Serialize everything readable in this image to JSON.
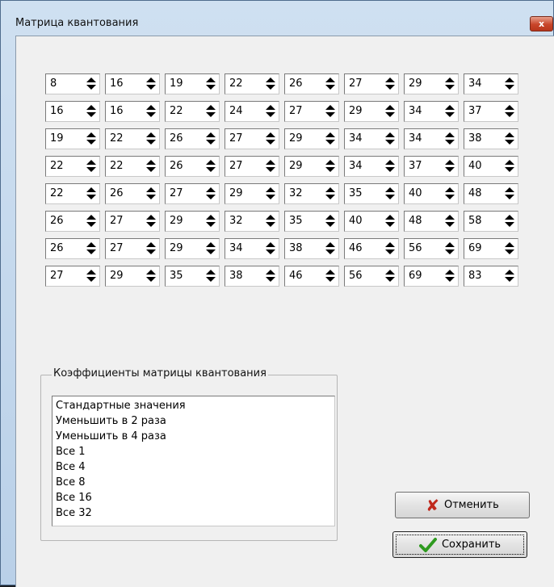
{
  "window": {
    "title": "Матрица квантования",
    "close_glyph": "x"
  },
  "matrix": [
    [
      "8",
      "16",
      "19",
      "22",
      "26",
      "27",
      "29",
      "34"
    ],
    [
      "16",
      "16",
      "22",
      "24",
      "27",
      "29",
      "34",
      "37"
    ],
    [
      "19",
      "22",
      "26",
      "27",
      "29",
      "34",
      "34",
      "38"
    ],
    [
      "22",
      "22",
      "26",
      "27",
      "29",
      "34",
      "37",
      "40"
    ],
    [
      "22",
      "26",
      "27",
      "29",
      "32",
      "35",
      "40",
      "48"
    ],
    [
      "26",
      "27",
      "29",
      "32",
      "35",
      "40",
      "48",
      "58"
    ],
    [
      "26",
      "27",
      "29",
      "34",
      "38",
      "46",
      "56",
      "69"
    ],
    [
      "27",
      "29",
      "35",
      "38",
      "46",
      "56",
      "69",
      "83"
    ]
  ],
  "coeffs": {
    "label": "Коэффициенты матрицы квантования",
    "items": [
      "Стандартные значения",
      "Уменьшить в 2 раза",
      "Уменьшить в 4 раза",
      "Все 1",
      "Все 4",
      "Все 8",
      "Все 16",
      "Все 32"
    ]
  },
  "buttons": {
    "cancel_label": "Отменить",
    "cancel_icon": "x-icon",
    "save_label": "Сохранить",
    "save_icon": "check-icon"
  },
  "colors": {
    "cancel_icon": "#c0281c",
    "save_icon": "#2e9a1f"
  }
}
